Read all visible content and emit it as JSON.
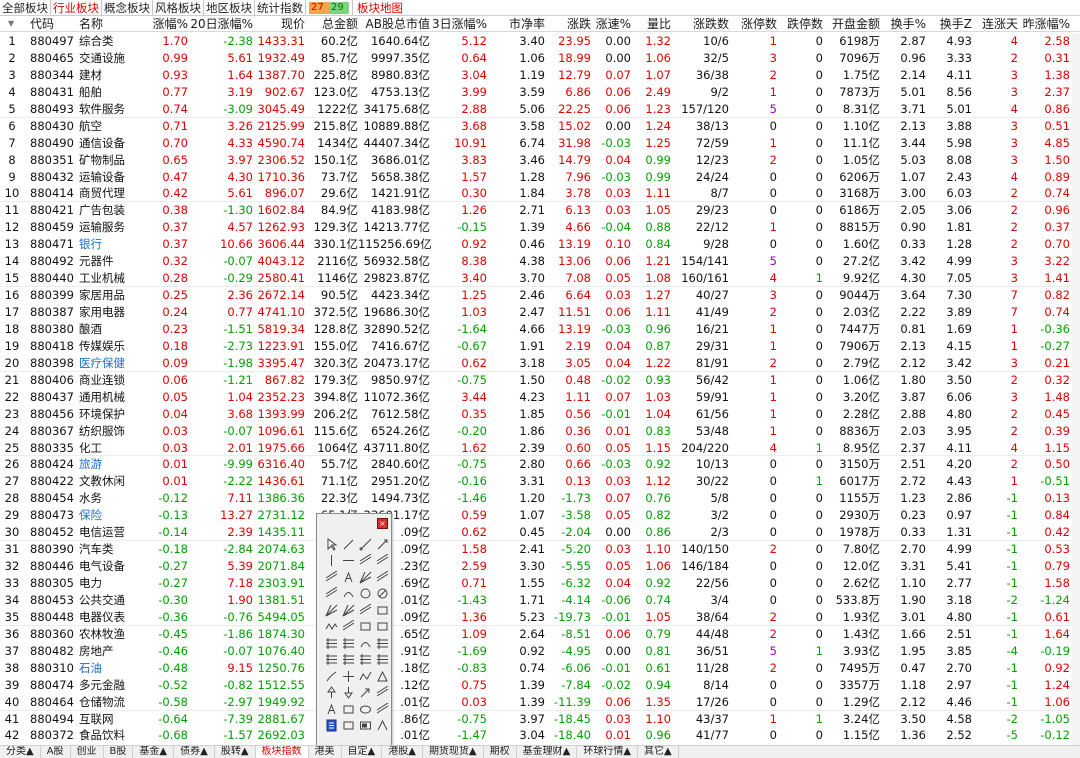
{
  "tabs": [
    "全部板块",
    "行业板块",
    "概念板块",
    "风格板块",
    "地区板块",
    "统计指数"
  ],
  "active_tab": "行业板块",
  "advance_decline": {
    "up": "27",
    "down": "29"
  },
  "map_tab": "板块地图",
  "columns": [
    "代码",
    "名称",
    "涨幅%",
    "20日涨幅%",
    "现价",
    "总金额",
    "AB股总市值",
    "3日涨幅%",
    "市净率",
    "涨跌",
    "涨速%",
    "量比",
    "涨跌数",
    "涨停数",
    "跌停数",
    "开盘金额",
    "换手%",
    "换手Z",
    "连涨天",
    "昨涨幅%"
  ],
  "rows": [
    [
      "1",
      "880497",
      "综合类",
      "1.70",
      "-2.38",
      "1433.31",
      "60.2亿",
      "1640.64亿",
      "5.12",
      "3.40",
      "23.95",
      "0.00",
      "1.32",
      "10/6",
      "1",
      "0",
      "6198万",
      "2.87",
      "4.93",
      "4",
      "2.58"
    ],
    [
      "2",
      "880465",
      "交通设施",
      "0.99",
      "5.61",
      "1932.49",
      "85.7亿",
      "9997.35亿",
      "0.64",
      "1.06",
      "18.99",
      "0.00",
      "1.06",
      "32/5",
      "3",
      "0",
      "7096万",
      "0.96",
      "3.33",
      "2",
      "0.31"
    ],
    [
      "3",
      "880344",
      "建材",
      "0.93",
      "1.64",
      "1387.70",
      "225.8亿",
      "8980.83亿",
      "3.04",
      "1.19",
      "12.79",
      "0.07",
      "1.07",
      "36/38",
      "2",
      "0",
      "1.75亿",
      "2.14",
      "4.11",
      "3",
      "1.38"
    ],
    [
      "4",
      "880431",
      "船舶",
      "0.77",
      "3.19",
      "902.67",
      "123.0亿",
      "4753.13亿",
      "3.99",
      "3.59",
      "6.86",
      "0.06",
      "2.49",
      "9/2",
      "1",
      "0",
      "7873万",
      "5.01",
      "8.56",
      "3",
      "2.37"
    ],
    [
      "5",
      "880493",
      "软件服务",
      "0.74",
      "-3.09",
      "3045.49",
      "1222亿",
      "34175.68亿",
      "2.88",
      "5.06",
      "22.25",
      "0.06",
      "1.23",
      "157/120",
      "5",
      "0",
      "8.31亿",
      "3.71",
      "5.01",
      "4",
      "0.86"
    ],
    [
      "6",
      "880430",
      "航空",
      "0.71",
      "3.26",
      "2125.99",
      "215.8亿",
      "10889.88亿",
      "3.68",
      "3.58",
      "15.02",
      "0.00",
      "1.24",
      "38/13",
      "0",
      "0",
      "1.10亿",
      "2.13",
      "3.88",
      "3",
      "0.51"
    ],
    [
      "7",
      "880490",
      "通信设备",
      "0.70",
      "4.33",
      "4590.74",
      "1434亿",
      "44407.34亿",
      "10.91",
      "6.74",
      "31.98",
      "-0.03",
      "1.25",
      "72/59",
      "1",
      "0",
      "11.1亿",
      "3.44",
      "5.98",
      "3",
      "4.85"
    ],
    [
      "8",
      "880351",
      "矿物制品",
      "0.65",
      "3.97",
      "2306.52",
      "150.1亿",
      "3686.01亿",
      "3.83",
      "3.46",
      "14.79",
      "0.04",
      "0.99",
      "12/23",
      "2",
      "0",
      "1.05亿",
      "5.03",
      "8.08",
      "3",
      "1.50"
    ],
    [
      "9",
      "880432",
      "运输设备",
      "0.47",
      "4.30",
      "1710.36",
      "73.7亿",
      "5658.38亿",
      "1.57",
      "1.28",
      "7.96",
      "-0.03",
      "0.99",
      "24/24",
      "0",
      "0",
      "6206万",
      "1.07",
      "2.43",
      "4",
      "0.89"
    ],
    [
      "10",
      "880414",
      "商贸代理",
      "0.42",
      "5.61",
      "896.07",
      "29.6亿",
      "1421.91亿",
      "0.30",
      "1.84",
      "3.78",
      "0.03",
      "1.11",
      "8/7",
      "0",
      "0",
      "3168万",
      "3.00",
      "6.03",
      "2",
      "0.74"
    ],
    [
      "11",
      "880421",
      "广告包装",
      "0.38",
      "-1.30",
      "1602.84",
      "84.9亿",
      "4183.98亿",
      "1.26",
      "2.71",
      "6.13",
      "0.03",
      "1.05",
      "29/23",
      "0",
      "0",
      "6186万",
      "2.05",
      "3.06",
      "2",
      "0.96"
    ],
    [
      "12",
      "880459",
      "运输服务",
      "0.37",
      "4.57",
      "1262.93",
      "129.3亿",
      "14213.77亿",
      "-0.15",
      "1.39",
      "4.66",
      "-0.04",
      "0.88",
      "22/12",
      "1",
      "0",
      "8815万",
      "0.90",
      "1.81",
      "2",
      "0.37"
    ],
    [
      "13",
      "880471",
      "银行",
      "0.37",
      "10.66",
      "3606.44",
      "330.1亿",
      "115256.69亿",
      "0.92",
      "0.46",
      "13.19",
      "0.10",
      "0.84",
      "9/28",
      "0",
      "0",
      "1.60亿",
      "0.33",
      "1.28",
      "2",
      "0.70"
    ],
    [
      "14",
      "880492",
      "元器件",
      "0.32",
      "-0.07",
      "4043.12",
      "2116亿",
      "56932.58亿",
      "8.38",
      "4.38",
      "13.06",
      "0.06",
      "1.21",
      "154/141",
      "5",
      "0",
      "27.2亿",
      "3.42",
      "4.99",
      "3",
      "3.22"
    ],
    [
      "15",
      "880440",
      "工业机械",
      "0.28",
      "-0.29",
      "2580.41",
      "1146亿",
      "29823.87亿",
      "3.40",
      "3.70",
      "7.08",
      "0.05",
      "1.08",
      "160/161",
      "4",
      "1",
      "9.92亿",
      "4.30",
      "7.05",
      "3",
      "1.41"
    ],
    [
      "16",
      "880399",
      "家居用品",
      "0.25",
      "2.36",
      "2672.14",
      "90.5亿",
      "4423.34亿",
      "1.25",
      "2.46",
      "6.64",
      "0.03",
      "1.27",
      "40/27",
      "3",
      "0",
      "9044万",
      "3.64",
      "7.30",
      "7",
      "0.82"
    ],
    [
      "17",
      "880387",
      "家用电器",
      "0.24",
      "0.77",
      "4741.10",
      "372.5亿",
      "19686.30亿",
      "1.03",
      "2.47",
      "11.51",
      "0.06",
      "1.11",
      "41/49",
      "2",
      "0",
      "2.03亿",
      "2.22",
      "3.89",
      "7",
      "0.74"
    ],
    [
      "18",
      "880380",
      "酿酒",
      "0.23",
      "-1.51",
      "5819.34",
      "128.8亿",
      "32890.52亿",
      "-1.64",
      "4.66",
      "13.19",
      "-0.03",
      "0.96",
      "16/21",
      "1",
      "0",
      "7447万",
      "0.81",
      "1.69",
      "1",
      "-0.36"
    ],
    [
      "19",
      "880418",
      "传媒娱乐",
      "0.18",
      "-2.73",
      "1223.91",
      "155.0亿",
      "7416.67亿",
      "-0.67",
      "1.91",
      "2.19",
      "0.04",
      "0.87",
      "29/31",
      "1",
      "0",
      "7906万",
      "2.13",
      "4.15",
      "1",
      "-0.27"
    ],
    [
      "20",
      "880398",
      "医疗保健",
      "0.09",
      "-1.98",
      "3395.47",
      "320.3亿",
      "20473.17亿",
      "0.62",
      "3.18",
      "3.05",
      "0.04",
      "1.22",
      "81/91",
      "2",
      "0",
      "2.79亿",
      "2.12",
      "3.42",
      "3",
      "0.21"
    ],
    [
      "21",
      "880406",
      "商业连锁",
      "0.06",
      "-1.21",
      "867.82",
      "179.3亿",
      "9850.97亿",
      "-0.75",
      "1.50",
      "0.48",
      "-0.02",
      "0.93",
      "56/42",
      "1",
      "0",
      "1.06亿",
      "1.80",
      "3.50",
      "2",
      "0.32"
    ],
    [
      "22",
      "880437",
      "通用机械",
      "0.05",
      "1.04",
      "2352.23",
      "394.8亿",
      "11072.36亿",
      "3.44",
      "4.23",
      "1.11",
      "0.07",
      "1.03",
      "59/91",
      "1",
      "0",
      "3.20亿",
      "3.87",
      "6.06",
      "3",
      "1.48"
    ],
    [
      "23",
      "880456",
      "环境保护",
      "0.04",
      "3.68",
      "1393.99",
      "206.2亿",
      "7612.58亿",
      "0.35",
      "1.85",
      "0.56",
      "-0.01",
      "1.04",
      "61/56",
      "1",
      "0",
      "2.28亿",
      "2.88",
      "4.80",
      "2",
      "0.45"
    ],
    [
      "24",
      "880367",
      "纺织服饰",
      "0.03",
      "-0.07",
      "1096.61",
      "115.6亿",
      "6524.26亿",
      "-0.20",
      "1.86",
      "0.36",
      "0.01",
      "0.83",
      "53/48",
      "1",
      "0",
      "8836万",
      "2.03",
      "3.95",
      "2",
      "0.39"
    ],
    [
      "25",
      "880335",
      "化工",
      "0.03",
      "2.01",
      "1975.66",
      "1064亿",
      "43711.80亿",
      "1.62",
      "2.39",
      "0.60",
      "0.05",
      "1.15",
      "204/220",
      "4",
      "1",
      "8.95亿",
      "2.37",
      "4.11",
      "4",
      "1.15"
    ],
    [
      "26",
      "880424",
      "旅游",
      "0.01",
      "-9.99",
      "6316.40",
      "55.7亿",
      "2840.60亿",
      "-0.75",
      "2.80",
      "0.66",
      "-0.03",
      "0.92",
      "10/13",
      "0",
      "0",
      "3150万",
      "2.51",
      "4.20",
      "2",
      "0.50"
    ],
    [
      "27",
      "880422",
      "文教休闲",
      "0.01",
      "-2.22",
      "1436.61",
      "71.1亿",
      "2951.20亿",
      "-0.16",
      "3.31",
      "0.13",
      "0.03",
      "1.12",
      "30/22",
      "0",
      "1",
      "6017万",
      "2.72",
      "4.43",
      "1",
      "-0.51"
    ],
    [
      "28",
      "880454",
      "水务",
      "-0.12",
      "7.11",
      "1386.36",
      "22.3亿",
      "1494.73亿",
      "-1.46",
      "1.20",
      "-1.73",
      "0.07",
      "0.76",
      "5/8",
      "0",
      "0",
      "1155万",
      "1.23",
      "2.86",
      "-1",
      "0.13"
    ],
    [
      "29",
      "880473",
      "保险",
      "-0.13",
      "13.27",
      "2731.12",
      "65.1亿",
      "23601.17亿",
      "0.59",
      "1.07",
      "-3.58",
      "0.05",
      "0.82",
      "3/2",
      "0",
      "0",
      "2930万",
      "0.23",
      "0.97",
      "-1",
      "0.84"
    ],
    [
      "30",
      "880452",
      "电信运营",
      "-0.14",
      "2.39",
      "1435.11",
      "",
      "",
      "0.62",
      "0.45",
      "-2.04",
      "0.00",
      "0.86",
      "2/3",
      "0",
      "0",
      "1978万",
      "0.33",
      "1.31",
      "-1",
      "0.42"
    ],
    [
      "31",
      "880390",
      "汽车类",
      "-0.18",
      "-2.84",
      "2074.63",
      "",
      "",
      "1.58",
      "2.41",
      "-5.20",
      "0.03",
      "1.10",
      "140/150",
      "2",
      "0",
      "7.80亿",
      "2.70",
      "4.99",
      "-1",
      "0.53"
    ],
    [
      "32",
      "880446",
      "电气设备",
      "-0.27",
      "5.39",
      "2071.84",
      "",
      "",
      "2.59",
      "3.30",
      "-5.55",
      "0.05",
      "1.06",
      "146/184",
      "0",
      "0",
      "12.0亿",
      "3.31",
      "5.41",
      "-1",
      "0.79"
    ],
    [
      "33",
      "880305",
      "电力",
      "-0.27",
      "7.18",
      "2303.91",
      "",
      "",
      "0.71",
      "1.55",
      "-6.32",
      "0.04",
      "0.92",
      "22/56",
      "0",
      "0",
      "2.62亿",
      "1.10",
      "2.77",
      "-1",
      "1.58"
    ],
    [
      "34",
      "880453",
      "公共交通",
      "-0.30",
      "1.90",
      "1381.51",
      "",
      "",
      "-1.43",
      "1.71",
      "-4.14",
      "-0.06",
      "0.74",
      "3/4",
      "0",
      "0",
      "533.8万",
      "1.90",
      "3.18",
      "-2",
      "-1.24"
    ],
    [
      "35",
      "880448",
      "电器仪表",
      "-0.36",
      "-0.76",
      "5494.05",
      "",
      "",
      "1.36",
      "5.23",
      "-19.73",
      "-0.01",
      "1.05",
      "38/64",
      "2",
      "0",
      "1.93亿",
      "3.01",
      "4.80",
      "-1",
      "0.61"
    ],
    [
      "36",
      "880360",
      "农林牧渔",
      "-0.45",
      "-1.86",
      "1874.30",
      "",
      "",
      "1.09",
      "2.64",
      "-8.51",
      "0.06",
      "0.79",
      "44/48",
      "2",
      "0",
      "1.43亿",
      "1.66",
      "2.51",
      "-1",
      "1.64"
    ],
    [
      "37",
      "880482",
      "房地产",
      "-0.46",
      "-0.07",
      "1076.40",
      "",
      "",
      "-1.69",
      "0.92",
      "-4.95",
      "0.00",
      "0.81",
      "36/51",
      "5",
      "1",
      "3.93亿",
      "1.95",
      "3.85",
      "-4",
      "-0.19"
    ],
    [
      "38",
      "880310",
      "石油",
      "-0.48",
      "9.15",
      "1250.76",
      "",
      "",
      "-0.83",
      "0.74",
      "-6.06",
      "-0.01",
      "0.61",
      "11/28",
      "2",
      "0",
      "7495万",
      "0.47",
      "2.70",
      "-1",
      "0.92"
    ],
    [
      "39",
      "880474",
      "多元金融",
      "-0.52",
      "-0.82",
      "1512.55",
      "",
      "",
      "0.75",
      "1.39",
      "-7.84",
      "-0.02",
      "0.94",
      "8/14",
      "0",
      "0",
      "3357万",
      "1.18",
      "2.97",
      "-1",
      "1.24"
    ],
    [
      "40",
      "880464",
      "仓储物流",
      "-0.58",
      "-2.97",
      "1949.92",
      "",
      "",
      "0.03",
      "1.39",
      "-11.39",
      "0.06",
      "1.35",
      "17/26",
      "0",
      "0",
      "1.29亿",
      "2.12",
      "4.46",
      "-1",
      "1.06"
    ],
    [
      "41",
      "880494",
      "互联网",
      "-0.64",
      "-7.39",
      "2881.67",
      "",
      "",
      "-0.75",
      "3.97",
      "-18.45",
      "0.03",
      "1.10",
      "43/37",
      "1",
      "1",
      "3.24亿",
      "3.50",
      "4.58",
      "-2",
      "-1.05"
    ],
    [
      "42",
      "880372",
      "食品饮料",
      "-0.68",
      "-1.57",
      "2692.03",
      "",
      "",
      "-1.47",
      "3.04",
      "-18.40",
      "0.01",
      "0.96",
      "41/77",
      "0",
      "0",
      "1.15亿",
      "1.36",
      "2.52",
      "-5",
      "-0.12"
    ]
  ],
  "tail_fragments": {
    "30": [
      "",
      "1.78亿",
      ".09亿"
    ],
    "31": [
      "",
      "",
      ".09亿"
    ],
    "32": [
      "",
      "",
      ".23亿"
    ],
    "33": [
      "",
      "",
      ".69亿"
    ],
    "34": [
      "",
      "",
      ".01亿"
    ],
    "35": [
      "",
      "",
      ".09亿"
    ],
    "36": [
      "",
      "",
      ".65亿"
    ],
    "37": [
      "",
      "",
      ".91亿"
    ],
    "38": [
      "",
      "",
      ".18亿"
    ],
    "39": [
      "",
      "",
      ".12亿"
    ],
    "40": [
      "",
      "",
      ".01亿"
    ],
    "41": [
      "",
      "",
      ".86亿"
    ],
    "42": [
      "",
      "",
      ".01亿"
    ]
  },
  "palette": {
    "close_label": "×"
  },
  "bottom_tabs": [
    "分类▲",
    "A股",
    "创业",
    "B股",
    "基金▲",
    "债券▲",
    "股转▲",
    "板块指数",
    "港美",
    "自定▲",
    "港股▲",
    "期货现货▲",
    "期权",
    "基金理财▲",
    "环球行情▲",
    "其它▲"
  ],
  "active_bottom_tab": "板块指数",
  "colors": {
    "up": "#e00000",
    "down": "#00a000",
    "neutral": "#111111",
    "link": "#1a6fd0",
    "limit": "#a000c8"
  }
}
